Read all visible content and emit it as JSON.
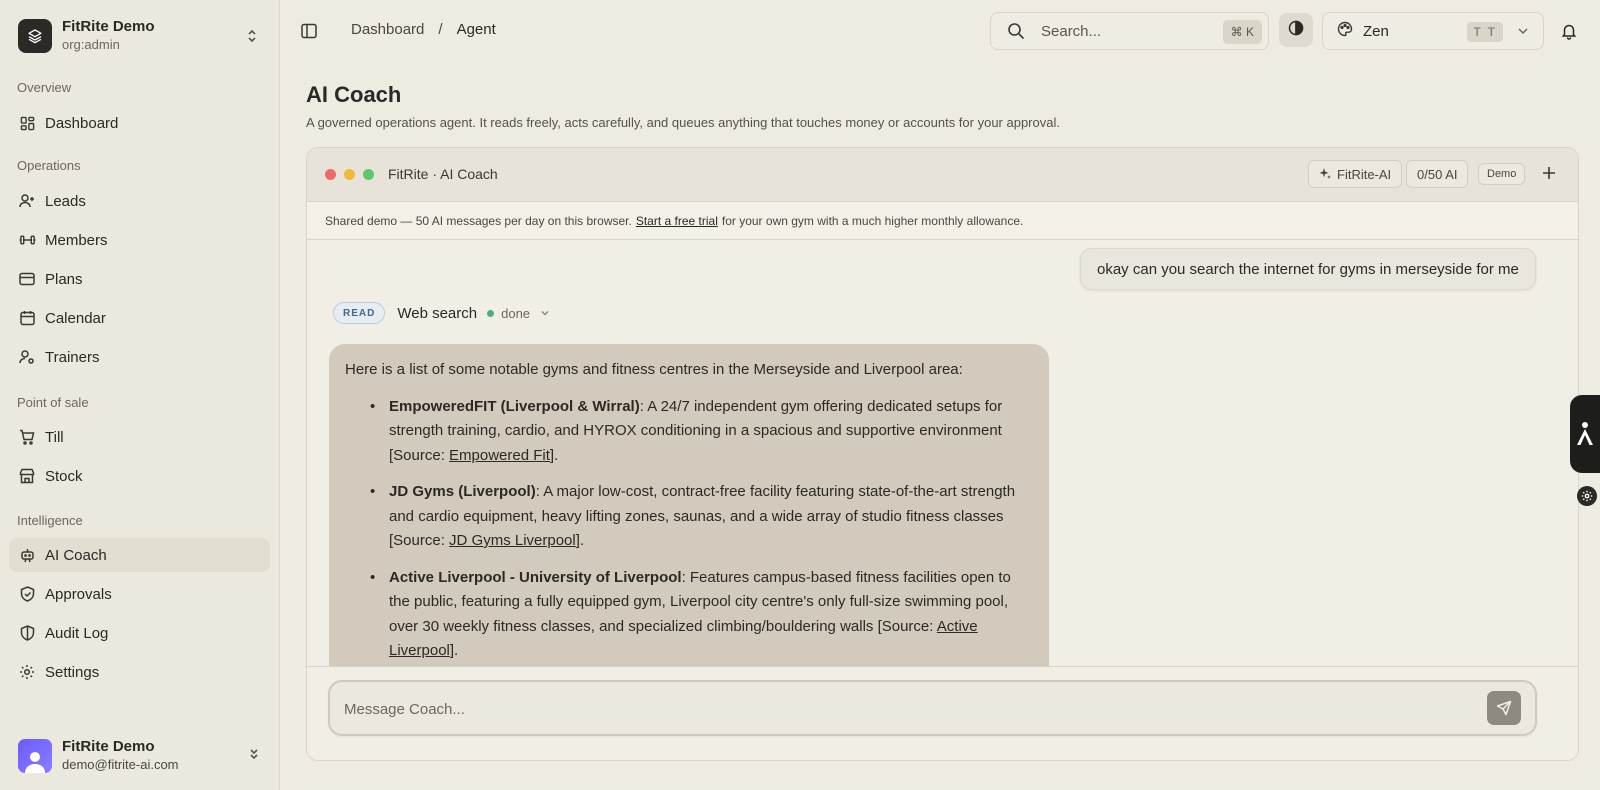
{
  "org": {
    "name": "FitRite Demo",
    "role": "org:admin"
  },
  "nav": {
    "overview": "Overview",
    "dashboard": "Dashboard",
    "operations": "Operations",
    "leads": "Leads",
    "members": "Members",
    "plans": "Plans",
    "calendar": "Calendar",
    "trainers": "Trainers",
    "pos": "Point of sale",
    "till": "Till",
    "stock": "Stock",
    "intelligence": "Intelligence",
    "ai_coach": "AI Coach",
    "approvals": "Approvals",
    "audit_log": "Audit Log",
    "settings": "Settings"
  },
  "user": {
    "name": "FitRite Demo",
    "email": "demo@fitrite-ai.com"
  },
  "breadcrumb": {
    "parent": "Dashboard",
    "separator": "/",
    "current": "Agent"
  },
  "search": {
    "placeholder": "Search...",
    "shortcut": "⌘ K"
  },
  "theme": {
    "name": "Zen",
    "badge": "T T"
  },
  "page": {
    "title": "AI Coach",
    "subtitle": "A governed operations agent. It reads freely, acts carefully, and queues anything that touches money or accounts for your approval."
  },
  "chat": {
    "window_title": "FitRite · AI Coach",
    "model_label": "FitRite-AI",
    "usage": "0/50 AI",
    "mode_badge": "Demo",
    "banner_prefix": "Shared demo — 50 AI messages per day on this browser.",
    "banner_link": "Start a free trial",
    "banner_suffix": "for your own gym with a much higher monthly allowance.",
    "user_message": "okay can you search the internet for gyms in merseyside for me",
    "tool": {
      "badge": "READ",
      "name": "Web search",
      "status": "done"
    },
    "ai_intro": "Here is a list of some notable gyms and fitness centres in the Merseyside and Liverpool area:",
    "results": [
      {
        "name": "EmpoweredFIT (Liverpool & Wirral)",
        "desc": ": A 24/7 independent gym offering dedicated setups for strength training, cardio, and HYROX conditioning in a spacious and supportive environment [Source: ",
        "source": "Empowered Fit",
        "end": "]."
      },
      {
        "name": "JD Gyms (Liverpool)",
        "desc": ": A major low-cost, contract-free facility featuring state-of-the-art strength and cardio equipment, heavy lifting zones, saunas, and a wide array of studio fitness classes [Source: ",
        "source": "JD Gyms Liverpool",
        "end": "]."
      },
      {
        "name": "Active Liverpool - University of Liverpool",
        "desc": ": Features campus-based fitness facilities open to the public, featuring a fully equipped gym, Liverpool city centre's only full-size swimming pool, over 30 weekly fitness classes, and specialized climbing/bouldering walls [Source: ",
        "source": "Active Liverpool",
        "end": "]."
      }
    ],
    "composer_placeholder": "Message Coach..."
  },
  "colors": {
    "accent": "#6a5cff",
    "status_done": "#4caf7a",
    "read_badge": "#3f6a8a"
  }
}
